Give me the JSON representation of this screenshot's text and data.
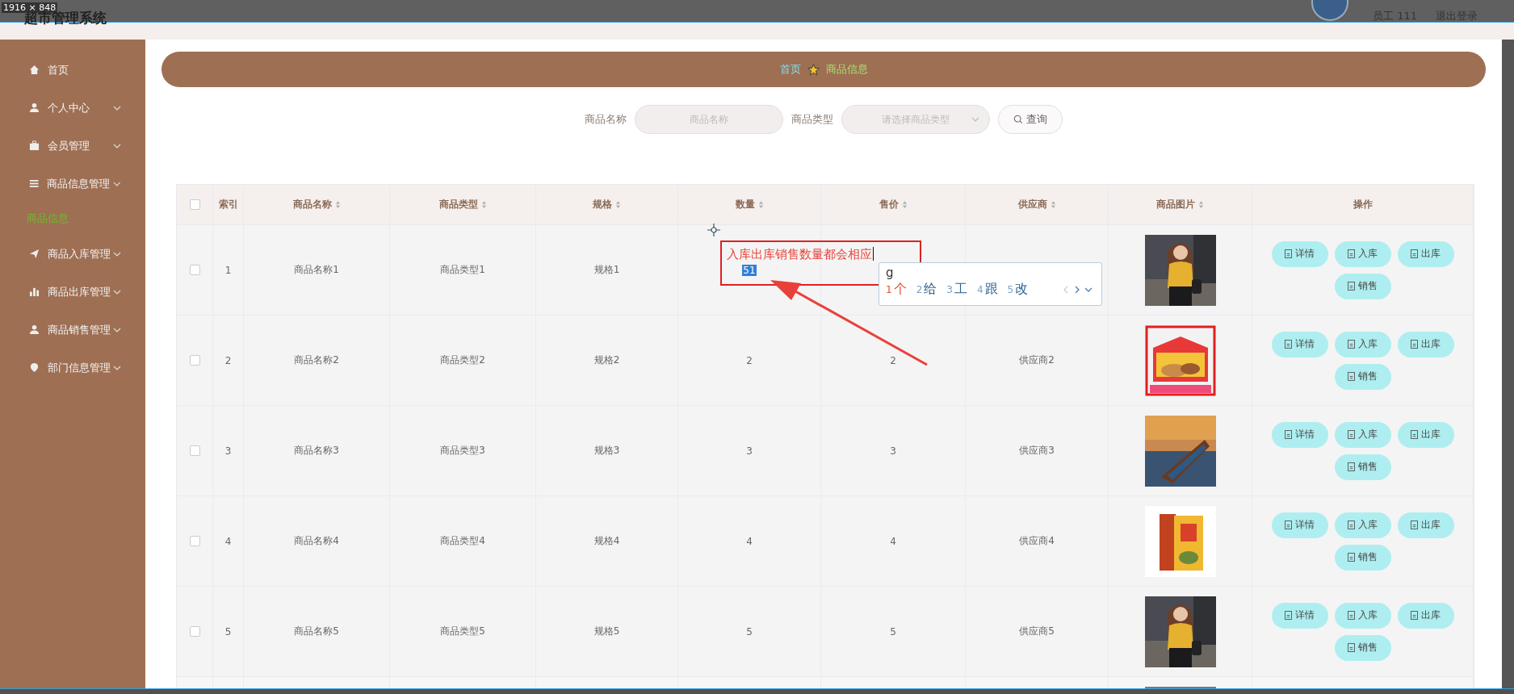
{
  "capture_label": "1916 × 848",
  "header": {
    "title": "超市管理系统",
    "user": "员工 111",
    "logout": "退出登录"
  },
  "sidebar": {
    "items": [
      {
        "label": "首页",
        "expandable": false
      },
      {
        "label": "个人中心",
        "expandable": true
      },
      {
        "label": "会员管理",
        "expandable": true
      },
      {
        "label": "商品信息管理",
        "expandable": true,
        "children": [
          {
            "label": "商品信息",
            "selected": true
          }
        ]
      },
      {
        "label": "商品入库管理",
        "expandable": true
      },
      {
        "label": "商品出库管理",
        "expandable": true
      },
      {
        "label": "商品销售管理",
        "expandable": true
      },
      {
        "label": "部门信息管理",
        "expandable": true
      }
    ]
  },
  "breadcrumb": [
    {
      "label": "首页",
      "color": "#7fe0f0"
    },
    {
      "label": "商品信息",
      "color": "#a8e070"
    }
  ],
  "search": {
    "fields": [
      {
        "label": "商品名称",
        "placeholder": "商品名称",
        "kind": "text"
      },
      {
        "label": "商品类型",
        "placeholder": "请选择商品类型",
        "kind": "select"
      }
    ],
    "button": "查询"
  },
  "table": {
    "select_all": {
      "checked": false
    },
    "columns": [
      {
        "label": "索引",
        "sortable": false
      },
      {
        "label": "商品名称",
        "sortable": true
      },
      {
        "label": "商品类型",
        "sortable": true
      },
      {
        "label": "规格",
        "sortable": true
      },
      {
        "label": "数量",
        "sortable": true
      },
      {
        "label": "售价",
        "sortable": true
      },
      {
        "label": "供应商",
        "sortable": true
      },
      {
        "label": "商品图片",
        "sortable": true
      },
      {
        "label": "操作",
        "sortable": false
      }
    ],
    "rows": [
      {
        "checked": false,
        "index": "1",
        "name": "商品名称1",
        "type": "商品类型1",
        "spec": "规格1",
        "quantity": "51",
        "quantity_selected": true,
        "actions": [
          "详情",
          "入库",
          "出库",
          "销售"
        ]
      },
      {
        "checked": false,
        "index": "2",
        "name": "商品名称2",
        "type": "商品类型2",
        "spec": "规格2",
        "quantity": "2",
        "quantity_selected": false,
        "price": "2",
        "supplier": "供应商2",
        "actions": [
          "详情",
          "入库",
          "出库",
          "销售"
        ]
      },
      {
        "checked": false,
        "index": "3",
        "name": "商品名称3",
        "type": "商品类型3",
        "spec": "规格3",
        "quantity": "3",
        "quantity_selected": false,
        "price": "3",
        "supplier": "供应商3",
        "actions": [
          "详情",
          "入库",
          "出库",
          "销售"
        ]
      },
      {
        "checked": false,
        "index": "4",
        "name": "商品名称4",
        "type": "商品类型4",
        "spec": "规格4",
        "quantity": "4",
        "quantity_selected": false,
        "price": "4",
        "supplier": "供应商4",
        "actions": [
          "详情",
          "入库",
          "出库",
          "销售"
        ]
      },
      {
        "checked": false,
        "index": "5",
        "name": "商品名称5",
        "type": "商品类型5",
        "spec": "规格5",
        "quantity": "5",
        "quantity_selected": false,
        "price": "5",
        "supplier": "供应商5",
        "actions": [
          "详情",
          "入库",
          "出库",
          "销售"
        ]
      },
      {
        "kind": "partial"
      }
    ]
  },
  "annotation": {
    "note": "入库出库销售数量都会相应"
  },
  "ime": {
    "input": "g",
    "candidates": [
      {
        "number": "1",
        "text": "个",
        "selected": true
      },
      {
        "number": "2",
        "text": "给",
        "selected": false
      },
      {
        "number": "3",
        "text": "工",
        "selected": false
      },
      {
        "number": "4",
        "text": "跟",
        "selected": false
      },
      {
        "number": "5",
        "text": "改",
        "selected": false
      }
    ]
  }
}
